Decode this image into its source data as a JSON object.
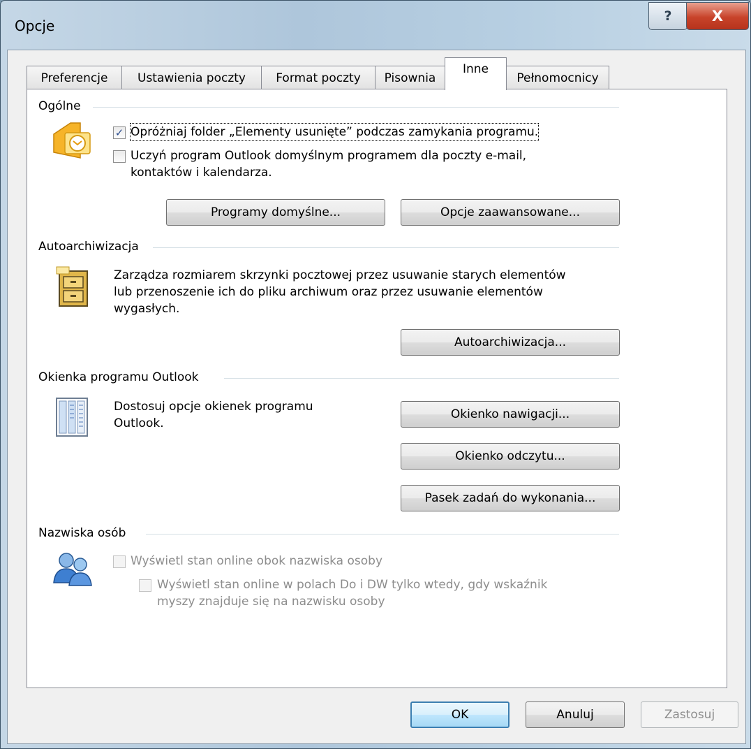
{
  "window": {
    "title": "Opcje",
    "help_symbol": "?",
    "close_symbol": "X"
  },
  "tabs": [
    {
      "label": "Preferencje"
    },
    {
      "label": "Ustawienia poczty"
    },
    {
      "label": "Format poczty"
    },
    {
      "label": "Pisownia"
    },
    {
      "label": "Inne"
    },
    {
      "label": "Pełnomocnicy"
    }
  ],
  "active_tab": "Inne",
  "general": {
    "title": "Ogólne",
    "icon": "outlook-icon",
    "empty_deleted": {
      "label": "Opróżniaj folder „Elementy usunięte” podczas zamykania programu.",
      "checked": true
    },
    "make_default": {
      "label_line1": "Uczyń program Outlook domyślnym programem dla poczty e-mail,",
      "label_line2": "kontaktów i kalendarza.",
      "checked": false
    },
    "default_programs_button": "Programy domyślne...",
    "advanced_options_button": "Opcje zaawansowane..."
  },
  "autoarchive": {
    "title": "Autoarchiwizacja",
    "icon": "file-cabinet-icon",
    "description_line1": "Zarządza rozmiarem skrzynki pocztowej przez usuwanie starych elementów",
    "description_line2": "lub przenoszenie ich do pliku archiwum oraz przez usuwanie elementów",
    "description_line3": "wygasłych.",
    "button": "Autoarchiwizacja..."
  },
  "panes": {
    "title": "Okienka programu Outlook",
    "icon": "panes-icon",
    "description_line1": "Dostosuj opcje okienek programu",
    "description_line2": "Outlook.",
    "navigation_button": "Okienko nawigacji...",
    "reading_button": "Okienko odczytu...",
    "todo_button": "Pasek zadań do wykonania..."
  },
  "people": {
    "title": "Nazwiska osób",
    "icon": "people-icon",
    "show_online": {
      "label": "Wyświetl stan online obok nazwiska osoby",
      "checked": false,
      "enabled": false
    },
    "show_online_hover": {
      "label_line1": "Wyświetl stan online w polach Do i DW tylko wtedy, gdy wskaźnik",
      "label_line2": "myszy znajduje się na nazwisku osoby",
      "checked": false,
      "enabled": false
    }
  },
  "footer": {
    "ok": "OK",
    "cancel": "Anuluj",
    "apply": "Zastosuj"
  }
}
